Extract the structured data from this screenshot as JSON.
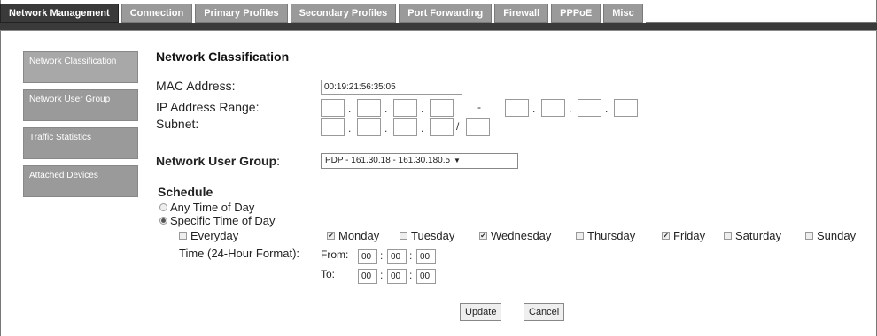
{
  "tabs": [
    {
      "label": "Network Management",
      "active": true
    },
    {
      "label": "Connection"
    },
    {
      "label": "Primary Profiles"
    },
    {
      "label": "Secondary Profiles"
    },
    {
      "label": "Port Forwarding"
    },
    {
      "label": "Firewall"
    },
    {
      "label": "PPPoE"
    },
    {
      "label": "Misc"
    }
  ],
  "sidebar": {
    "items": [
      {
        "label": "Network Classification",
        "active": true
      },
      {
        "label": "Network User Group"
      },
      {
        "label": "Traffic Statistics"
      },
      {
        "label": "Attached Devices"
      }
    ]
  },
  "main": {
    "section_title": "Network Classification",
    "mac_label": "MAC Address:",
    "mac_value": "00:19:21:56:35:05",
    "ip_range_label": "IP Address Range:",
    "ip_range_dash": "-",
    "subnet_label": "Subnet:",
    "subnet_slash": "/",
    "user_group_label": "Network User Group",
    "user_group_colon": ":",
    "user_group_selected": "PDP - 161.30.18  -  161.30.180.5",
    "schedule_title": "Schedule",
    "any_time_label": "Any Time of Day",
    "specific_time_label": "Specific Time of Day",
    "everyday_label": "Everyday",
    "days": [
      {
        "label": "Monday",
        "checked": true
      },
      {
        "label": "Tuesday",
        "checked": false
      },
      {
        "label": "Wednesday",
        "checked": true
      },
      {
        "label": "Thursday",
        "checked": false
      },
      {
        "label": "Friday",
        "checked": true
      },
      {
        "label": "Saturday",
        "checked": false
      },
      {
        "label": "Sunday",
        "checked": false
      }
    ],
    "time_format_label": "Time (24-Hour Format):",
    "from_label": "From:",
    "to_label": "To:",
    "from_hh": "00",
    "from_mm": "00",
    "from_ss": "00",
    "to_hh": "00",
    "to_mm": "00",
    "to_ss": "00",
    "time_sep": ":",
    "update_label": "Update",
    "cancel_label": "Cancel"
  }
}
